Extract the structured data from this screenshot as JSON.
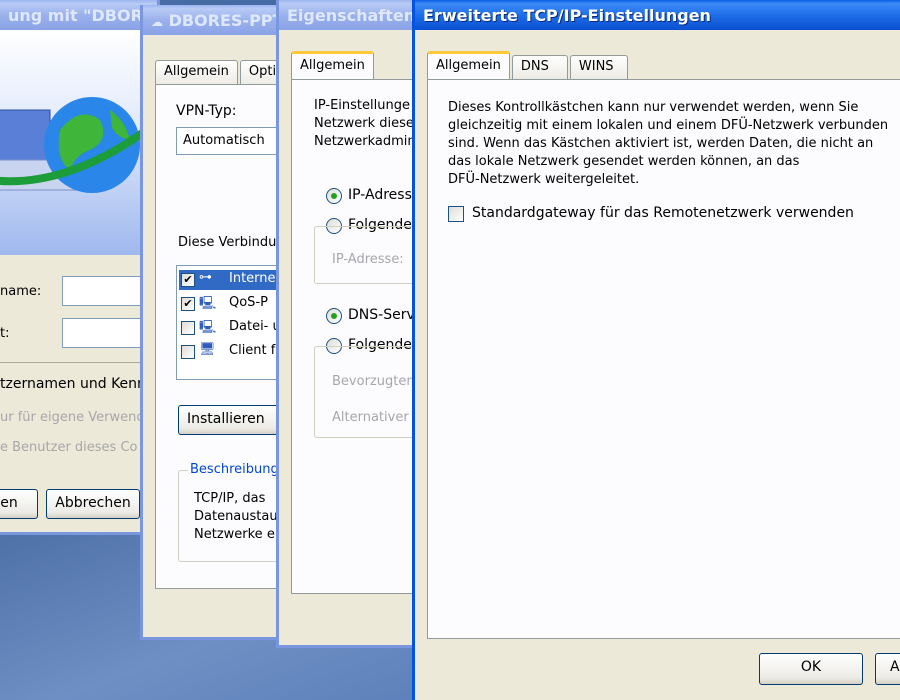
{
  "dialup_window": {
    "title": "ung mit \"DBORES",
    "username_label": "name:",
    "password_label": "t:",
    "save_label": "tzernamen und Kenn",
    "option1": "ur für eigene Verwenc",
    "option2": "e Benutzer dieses Co",
    "connect_button": "en",
    "cancel_button": "Abbrechen"
  },
  "vpn_window": {
    "title": "DBORES-PPT",
    "tabs": [
      "Allgemein",
      "Optic"
    ],
    "vpn_type_label": "VPN-Typ:",
    "vpn_type_value": "Automatisch",
    "components_label": "Diese Verbindu",
    "components": [
      {
        "label": "Interne",
        "checked": true,
        "icon": "network-protocol-icon"
      },
      {
        "label": "QoS-P",
        "checked": true,
        "icon": "network-service-icon"
      },
      {
        "label": "Datei- u",
        "checked": false,
        "icon": "network-service-icon"
      },
      {
        "label": "Client f",
        "checked": false,
        "icon": "network-client-icon"
      }
    ],
    "install_button": "Installieren",
    "description_legend": "Beschreibung",
    "description_lines": [
      "TCP/IP, das",
      "Datenaustau",
      "Netzwerke e"
    ]
  },
  "properties_window": {
    "title": "Eigenschaften",
    "tab": "Allgemein",
    "intro_lines": [
      "IP-Einstellunge",
      "Netzwerk diese",
      "Netzwerkadmin"
    ],
    "ip_auto": "IP-Adress",
    "ip_manual": "Folgende",
    "ip_address_label": "IP-Adresse:",
    "dns_auto": "DNS-Serv",
    "dns_manual": "Folgende",
    "preferred_dns_label": "Bevorzugter",
    "alternate_dns_label": "Alternativer l"
  },
  "tcpip_window": {
    "title": "Erweiterte TCP/IP-Einstellungen",
    "tabs": [
      "Allgemein",
      "DNS",
      "WINS"
    ],
    "description_lines": [
      "Dieses Kontrollkästchen kann nur verwendet werden, wenn Sie",
      "gleichzeitig mit einem lokalen und einem DFÜ-Netzwerk verbunden",
      "sind. Wenn das Kästchen aktiviert ist, werden Daten, die nicht an",
      "das lokale Netzwerk gesendet werden können, an das",
      "DFÜ-Netzwerk weitergeleitet."
    ],
    "gateway_checkbox_label": "Standardgateway für das Remotenetzwerk verwenden",
    "gateway_checked": false,
    "ok_button": "OK",
    "cancel_button": "Al"
  },
  "colors": {
    "titlebar_active": "#0a5fe6",
    "dialog_face": "#ece9d8",
    "tab_highlight": "#ffc83c"
  }
}
